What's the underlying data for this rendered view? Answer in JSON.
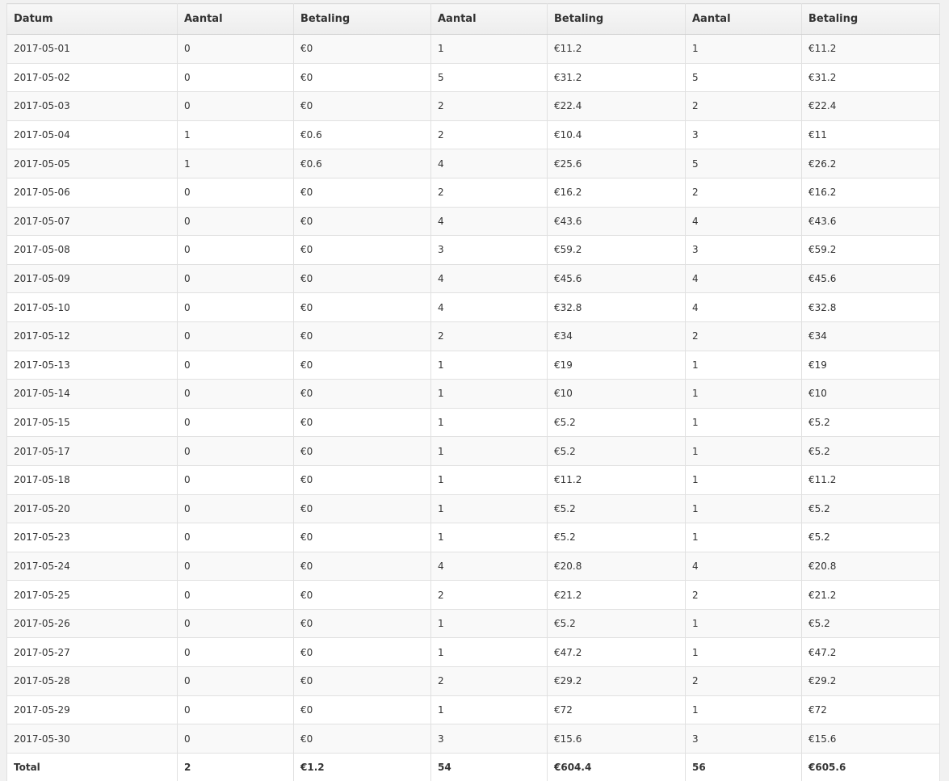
{
  "table": {
    "headers": [
      "Datum",
      "Aantal",
      "Betaling",
      "Aantal",
      "Betaling",
      "Aantal",
      "Betaling"
    ],
    "rows": [
      [
        "2017-05-01",
        "0",
        "€0",
        "1",
        "€11.2",
        "1",
        "€11.2"
      ],
      [
        "2017-05-02",
        "0",
        "€0",
        "5",
        "€31.2",
        "5",
        "€31.2"
      ],
      [
        "2017-05-03",
        "0",
        "€0",
        "2",
        "€22.4",
        "2",
        "€22.4"
      ],
      [
        "2017-05-04",
        "1",
        "€0.6",
        "2",
        "€10.4",
        "3",
        "€11"
      ],
      [
        "2017-05-05",
        "1",
        "€0.6",
        "4",
        "€25.6",
        "5",
        "€26.2"
      ],
      [
        "2017-05-06",
        "0",
        "€0",
        "2",
        "€16.2",
        "2",
        "€16.2"
      ],
      [
        "2017-05-07",
        "0",
        "€0",
        "4",
        "€43.6",
        "4",
        "€43.6"
      ],
      [
        "2017-05-08",
        "0",
        "€0",
        "3",
        "€59.2",
        "3",
        "€59.2"
      ],
      [
        "2017-05-09",
        "0",
        "€0",
        "4",
        "€45.6",
        "4",
        "€45.6"
      ],
      [
        "2017-05-10",
        "0",
        "€0",
        "4",
        "€32.8",
        "4",
        "€32.8"
      ],
      [
        "2017-05-12",
        "0",
        "€0",
        "2",
        "€34",
        "2",
        "€34"
      ],
      [
        "2017-05-13",
        "0",
        "€0",
        "1",
        "€19",
        "1",
        "€19"
      ],
      [
        "2017-05-14",
        "0",
        "€0",
        "1",
        "€10",
        "1",
        "€10"
      ],
      [
        "2017-05-15",
        "0",
        "€0",
        "1",
        "€5.2",
        "1",
        "€5.2"
      ],
      [
        "2017-05-17",
        "0",
        "€0",
        "1",
        "€5.2",
        "1",
        "€5.2"
      ],
      [
        "2017-05-18",
        "0",
        "€0",
        "1",
        "€11.2",
        "1",
        "€11.2"
      ],
      [
        "2017-05-20",
        "0",
        "€0",
        "1",
        "€5.2",
        "1",
        "€5.2"
      ],
      [
        "2017-05-23",
        "0",
        "€0",
        "1",
        "€5.2",
        "1",
        "€5.2"
      ],
      [
        "2017-05-24",
        "0",
        "€0",
        "4",
        "€20.8",
        "4",
        "€20.8"
      ],
      [
        "2017-05-25",
        "0",
        "€0",
        "2",
        "€21.2",
        "2",
        "€21.2"
      ],
      [
        "2017-05-26",
        "0",
        "€0",
        "1",
        "€5.2",
        "1",
        "€5.2"
      ],
      [
        "2017-05-27",
        "0",
        "€0",
        "1",
        "€47.2",
        "1",
        "€47.2"
      ],
      [
        "2017-05-28",
        "0",
        "€0",
        "2",
        "€29.2",
        "2",
        "€29.2"
      ],
      [
        "2017-05-29",
        "0",
        "€0",
        "1",
        "€72",
        "1",
        "€72"
      ],
      [
        "2017-05-30",
        "0",
        "€0",
        "3",
        "€15.6",
        "3",
        "€15.6"
      ]
    ],
    "footer": [
      "Total",
      "2",
      "€1.2",
      "54",
      "€604.4",
      "56",
      "€605.6"
    ]
  }
}
